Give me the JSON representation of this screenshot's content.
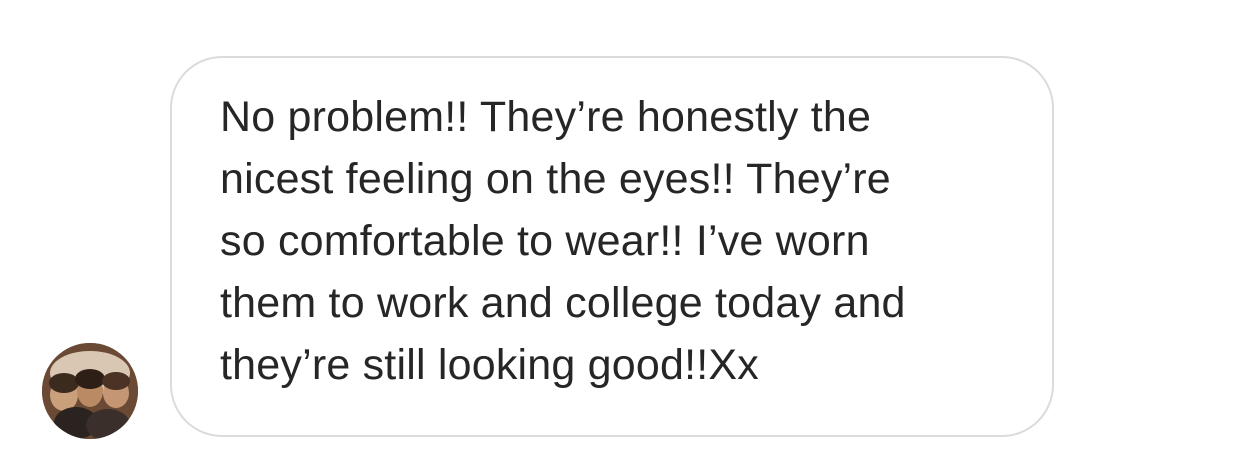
{
  "conversation": {
    "messages": [
      {
        "sender": "other",
        "text": "No problem!! They’re honestly the\nnicest feeling on the eyes!! They’re\nso comfortable to wear!! I’ve worn\nthem to work and college today and\nthey’re still looking good!!Xx"
      }
    ]
  },
  "colors": {
    "bubble_border": "#dbdbdb",
    "text": "#262626",
    "background": "#ffffff"
  },
  "icons": {
    "avatar": "sender-avatar-photo"
  }
}
